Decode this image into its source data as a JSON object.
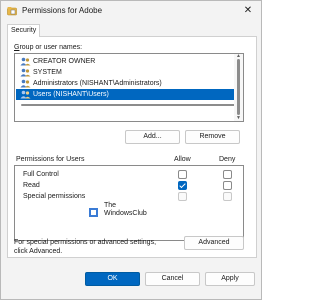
{
  "window": {
    "title": "Permissions for Adobe",
    "close_glyph": "✕"
  },
  "tabs": [
    {
      "label": "Security"
    }
  ],
  "group": {
    "label": "Group or user names:",
    "label_mnemonic": "G",
    "label_rest": "roup or user names:",
    "users": [
      {
        "name": "CREATOR OWNER",
        "selected": false
      },
      {
        "name": "SYSTEM",
        "selected": false
      },
      {
        "name": "Administrators (NISHANT\\Administrators)",
        "selected": false
      },
      {
        "name": "Users (NISHANT\\Users)",
        "selected": true
      }
    ],
    "add_label": "Add...",
    "remove_label": "Remove"
  },
  "permissions": {
    "header": "Permissions for Users",
    "allow_header": "Allow",
    "deny_header": "Deny",
    "rows": [
      {
        "name": "Full Control",
        "allow": false,
        "deny": false,
        "disabled": false
      },
      {
        "name": "Read",
        "allow": true,
        "deny": false,
        "disabled": false
      },
      {
        "name": "Special permissions",
        "allow": false,
        "deny": false,
        "disabled": true
      }
    ]
  },
  "watermark": {
    "line1": "The",
    "line2": "WindowsClub"
  },
  "special": {
    "note_line1": "For special permissions or advanced settings,",
    "note_line2": "click Advanced.",
    "advanced_label": "Advanced"
  },
  "footer": {
    "ok_label": "OK",
    "cancel_label": "Cancel",
    "apply_label": "Apply"
  },
  "colors": {
    "accent": "#0067c0",
    "window_bg": "#f3f3f3",
    "panel_bg": "#ffffff"
  },
  "icons": {
    "title": "folder-shield-icon",
    "user": "user-group-icon"
  }
}
